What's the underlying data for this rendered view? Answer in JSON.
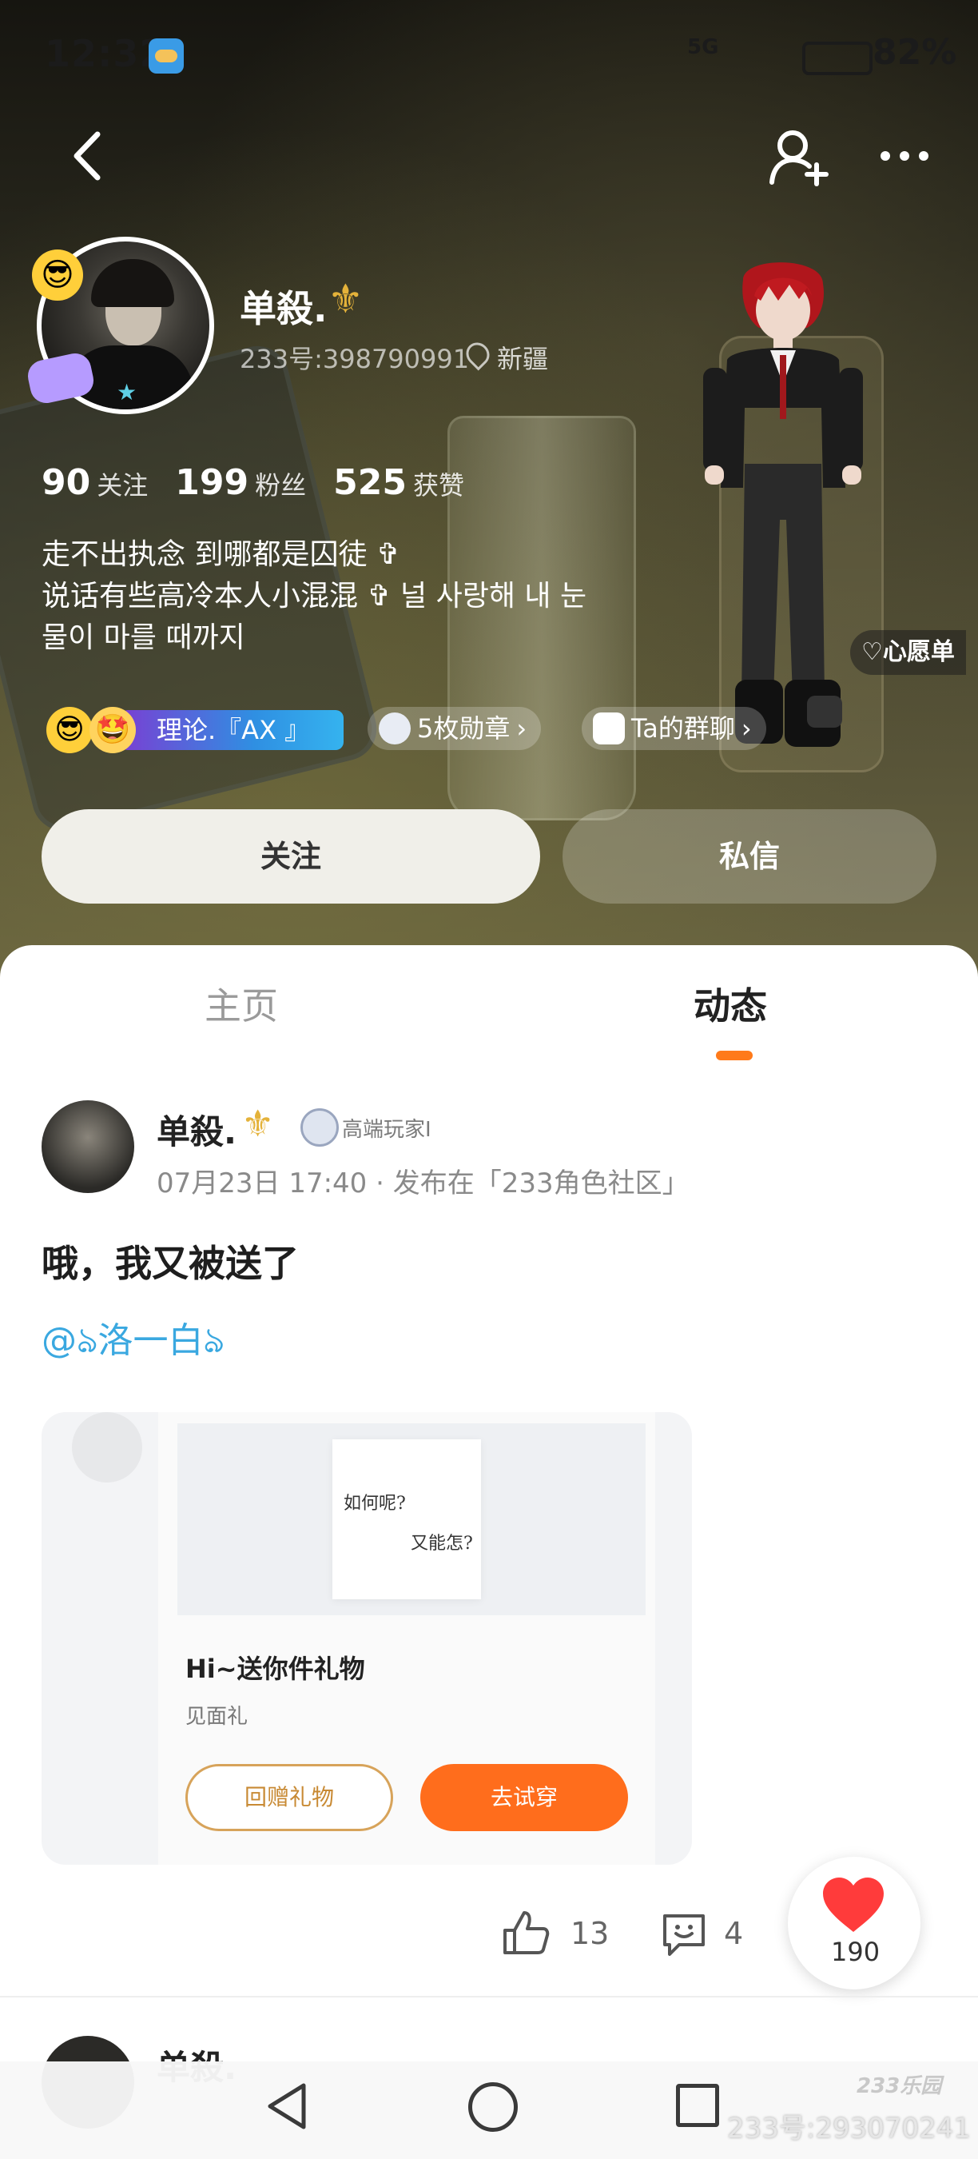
{
  "status_bar": {
    "time": "12:32",
    "signal": "5G",
    "battery": "82%"
  },
  "profile": {
    "name": "单殺.",
    "name_symbol": "⚜",
    "uid": "233号:398790991",
    "location": "新疆",
    "stats": [
      {
        "count": "90",
        "label": "关注"
      },
      {
        "count": "199",
        "label": "粉丝"
      },
      {
        "count": "525",
        "label": "获赞"
      }
    ],
    "bio": [
      "走不出执念 到哪都是囚徒 ✞",
      "说话有些高冷本人小混混 ✞ 널 사랑해 내 눈",
      "물이 마를 때까지"
    ],
    "title_badge": "理论.『AX 』",
    "medals": "5枚勋章",
    "group_chat": "Ta的群聊",
    "wishlist": "心愿单",
    "follow_button": "关注",
    "message_button": "私信"
  },
  "tabs": {
    "home": "主页",
    "feed": "动态",
    "active": "feed"
  },
  "post": {
    "author": "单殺.",
    "author_symbol": "⚜",
    "level_label": "高端玩家I",
    "meta": "07月23日 17:40 · 发布在「233角色社区」",
    "text": "哦，我又被送了",
    "mention": "@ঌ洛一白ঌ",
    "gift": {
      "note_line1": "如何呢?",
      "note_line2": "又能怎?",
      "title": "Hi~送你件礼物",
      "subtitle": "见面礼",
      "return_button": "回赠礼物",
      "try_button": "去试穿"
    },
    "likes": "13",
    "comments": "4",
    "hearts": "190"
  },
  "next_post": {
    "author": "单殺."
  },
  "watermark": {
    "logo": "233乐园",
    "id": "233号:293070241"
  },
  "colors": {
    "accent": "#ff7a1a",
    "mention": "#3aa8e0",
    "gold": "#e4b23a",
    "heart": "#ff3b3b"
  },
  "icons": [
    "back-icon",
    "add-user-icon",
    "more-icon",
    "location-icon",
    "heart-outline-icon",
    "chevron-right-icon",
    "thumbs-up-icon",
    "comment-icon",
    "heart-icon",
    "nav-back-icon",
    "nav-home-icon",
    "nav-recent-icon"
  ]
}
